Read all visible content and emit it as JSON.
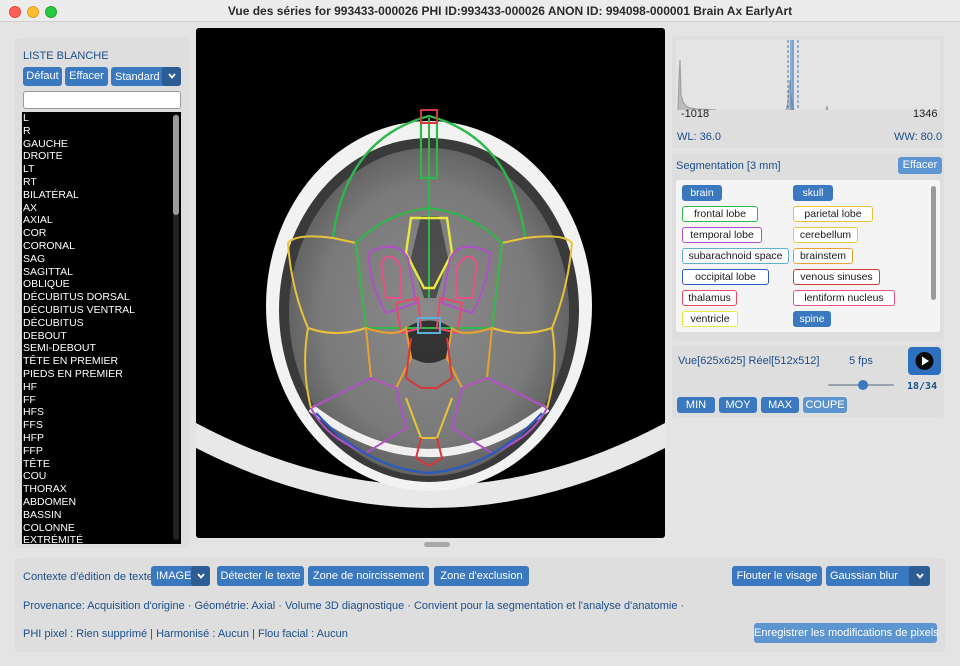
{
  "window": {
    "title": "Vue des séries for 993433-000026 PHI ID:993433-000026 ANON ID: 994098-000001 Brain Ax EarlyArt"
  },
  "whitelist": {
    "title": "LISTE BLANCHE",
    "default_label": "Défaut",
    "clear_label": "Effacer",
    "preset_value": "Standard",
    "search_value": "",
    "items": [
      "L",
      "R",
      "GAUCHE",
      "DROITE",
      "LT",
      "RT",
      "BILATÉRAL",
      "AX",
      "AXIAL",
      "COR",
      "CORONAL",
      "SAG",
      "SAGITTAL",
      "OBLIQUE",
      "DÉCUBITUS DORSAL",
      "DÉCUBITUS VENTRAL",
      "DÉCUBITUS",
      "DEBOUT",
      "SEMI-DEBOUT",
      "TÊTE EN PREMIER",
      "PIEDS EN PREMIER",
      "HF",
      "FF",
      "HFS",
      "FFS",
      "HFP",
      "FFP",
      "TÊTE",
      "COU",
      "THORAX",
      "ABDOMEN",
      "BASSIN",
      "COLONNE",
      "EXTRÉMITÉ"
    ]
  },
  "histogram": {
    "min_label": "-1018",
    "max_label": "1346",
    "wl": "WL: 36.0",
    "ww": "WW: 80.0"
  },
  "segmentation": {
    "title": "Segmentation [3 mm]",
    "clear_label": "Effacer",
    "labels": [
      {
        "name": "brain",
        "color": "#3a78c0",
        "filled": true
      },
      {
        "name": "skull",
        "color": "#3a78c0",
        "filled": true
      },
      {
        "name": "frontal lobe",
        "color": "#2db84a",
        "filled": false
      },
      {
        "name": "parietal lobe",
        "color": "#e9c23a",
        "filled": false
      },
      {
        "name": "temporal lobe",
        "color": "#b050c8",
        "filled": false
      },
      {
        "name": "cerebellum",
        "color": "#e8c840",
        "filled": false
      },
      {
        "name": "subarachnoid space",
        "color": "#5ab0d8",
        "filled": false
      },
      {
        "name": "brainstem",
        "color": "#e8a030",
        "filled": false
      },
      {
        "name": "occipital lobe",
        "color": "#2f5bb8",
        "filled": false
      },
      {
        "name": "venous sinuses",
        "color": "#d83838",
        "filled": false
      },
      {
        "name": "thalamus",
        "color": "#e84a6a",
        "filled": false
      },
      {
        "name": "lentiform nucleus",
        "color": "#e8508a",
        "filled": false
      },
      {
        "name": "ventricle",
        "color": "#e8e840",
        "filled": false
      },
      {
        "name": "spine",
        "color": "#3a78c0",
        "filled": true
      }
    ]
  },
  "playback": {
    "view": "Vue[625x625] Réel[512x512]",
    "fps": "5 fps",
    "frame": "18/34",
    "progress": 0.53,
    "buttons": [
      "MIN",
      "MOY",
      "MAX",
      "COUPE"
    ]
  },
  "bottom": {
    "context_label": "Contexte d'édition de texte:",
    "context_value": "IMAGE",
    "detect_label": "Détecter le texte",
    "blackout_label": "Zone de noircissement",
    "exclusion_label": "Zone d'exclusion",
    "blur_face_label": "Flouter le visage",
    "blur_type_value": "Gaussian blur",
    "provenance": "Provenance: Acquisition d'origine · Géométrie: Axial · Volume 3D diagnostique · Convient pour la segmentation et l'analyse d'anatomie ·",
    "phi": "PHI pixel : Rien supprimé | Harmonisé : Aucun | Flou facial : Aucun",
    "save_label": "Enregistrer les modifications de pixels"
  }
}
